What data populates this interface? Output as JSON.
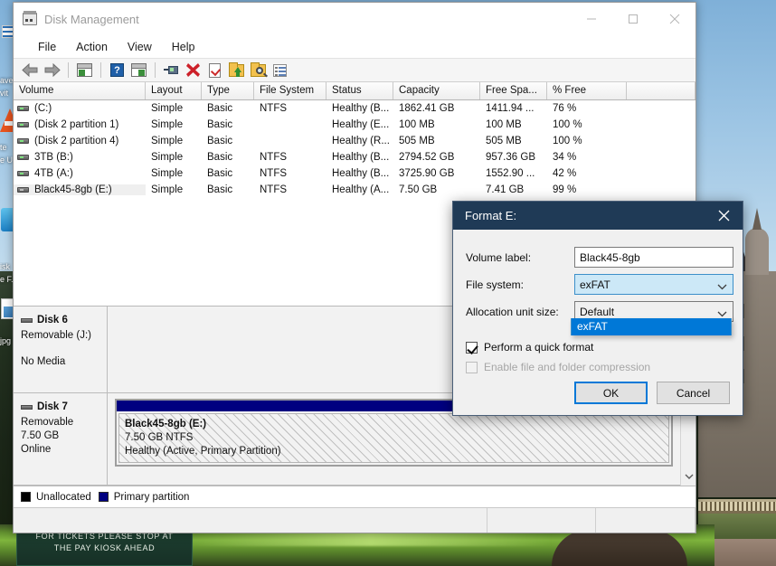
{
  "desktop": {
    "wallpaper_sign": [
      "FOR TICKETS PLEASE STOP AT",
      "THE PAY KIOSK AHEAD"
    ],
    "icon_labels": [
      "ave",
      "vit",
      "te",
      "e U",
      "isk",
      "e F.",
      "jpg"
    ]
  },
  "window": {
    "title": "Disk Management",
    "icon": "disk-management-icon",
    "controls": {
      "minimize": "minimize-icon",
      "maximize": "maximize-icon",
      "close": "close-icon"
    },
    "menu": [
      "File",
      "Action",
      "View",
      "Help"
    ],
    "toolbar_icons": [
      "back-arrow-icon",
      "forward-arrow-icon",
      "show-hide-console-tree-icon",
      "help-icon",
      "show-action-pane-icon",
      "connect-icon",
      "delete-icon",
      "properties-icon",
      "export-folder-icon",
      "search-folder-icon",
      "options-list-icon"
    ]
  },
  "volume_table": {
    "columns": [
      "Volume",
      "Layout",
      "Type",
      "File System",
      "Status",
      "Capacity",
      "Free Spa...",
      "% Free",
      ""
    ],
    "rows": [
      {
        "volume": "(C:)",
        "layout": "Simple",
        "type": "Basic",
        "file_system": "NTFS",
        "status": "Healthy (B...",
        "capacity": "1862.41 GB",
        "free_space": "1411.94 ...",
        "percent_free": "76 %",
        "selected": false
      },
      {
        "volume": "(Disk 2 partition 1)",
        "layout": "Simple",
        "type": "Basic",
        "file_system": "",
        "status": "Healthy (E...",
        "capacity": "100 MB",
        "free_space": "100 MB",
        "percent_free": "100 %",
        "selected": false
      },
      {
        "volume": "(Disk 2 partition 4)",
        "layout": "Simple",
        "type": "Basic",
        "file_system": "",
        "status": "Healthy (R...",
        "capacity": "505 MB",
        "free_space": "505 MB",
        "percent_free": "100 %",
        "selected": false
      },
      {
        "volume": "3TB (B:)",
        "layout": "Simple",
        "type": "Basic",
        "file_system": "NTFS",
        "status": "Healthy (B...",
        "capacity": "2794.52 GB",
        "free_space": "957.36 GB",
        "percent_free": "34 %",
        "selected": false
      },
      {
        "volume": "4TB (A:)",
        "layout": "Simple",
        "type": "Basic",
        "file_system": "NTFS",
        "status": "Healthy (B...",
        "capacity": "3725.90 GB",
        "free_space": "1552.90 ...",
        "percent_free": "42 %",
        "selected": false
      },
      {
        "volume": "Black45-8gb (E:)",
        "layout": "Simple",
        "type": "Basic",
        "file_system": "NTFS",
        "status": "Healthy (A...",
        "capacity": "7.50 GB",
        "free_space": "7.41 GB",
        "percent_free": "99 %",
        "selected": true
      }
    ]
  },
  "disks": [
    {
      "name": "Disk 6",
      "line2": "Removable (J:)",
      "line3": "",
      "line4": "No Media",
      "has_partition": false
    },
    {
      "name": "Disk 7",
      "line2": "Removable",
      "line3": "7.50 GB",
      "line4": "Online",
      "has_partition": true,
      "partition": {
        "name": "Black45-8gb  (E:)",
        "size_fs": "7.50 GB NTFS",
        "status": "Healthy (Active, Primary Partition)",
        "bar_color": "#000080"
      }
    }
  ],
  "legend": [
    {
      "label": "Unallocated",
      "color": "#000000"
    },
    {
      "label": "Primary partition",
      "color": "#000080"
    }
  ],
  "format_dialog": {
    "title": "Format E:",
    "close_icon": "close-icon",
    "fields": {
      "volume_label": {
        "label": "Volume label:",
        "value": "Black45-8gb"
      },
      "file_system": {
        "label": "File system:",
        "value": "exFAT",
        "open": true,
        "options": [
          "exFAT"
        ]
      },
      "allocation_unit_size": {
        "label": "Allocation unit size:",
        "value": "Default"
      }
    },
    "checkboxes": [
      {
        "label": "Perform a quick format",
        "checked": true,
        "disabled": false
      },
      {
        "label": "Enable file and folder compression",
        "checked": false,
        "disabled": true
      }
    ],
    "buttons": {
      "ok": "OK",
      "cancel": "Cancel"
    },
    "accent_color": "#0078d7",
    "titlebar_color": "#1f3a56"
  }
}
